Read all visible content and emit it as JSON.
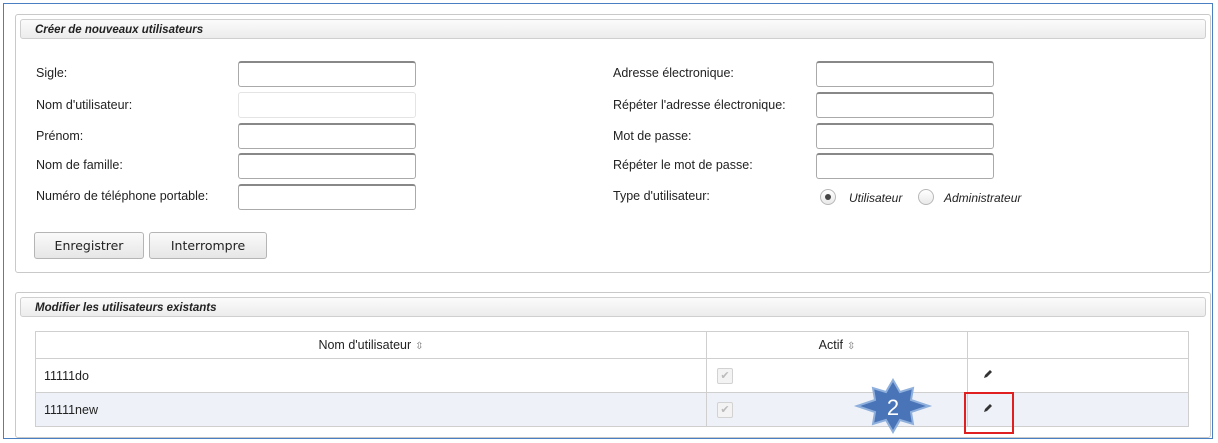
{
  "create_panel": {
    "title": "Créer de nouveaux utilisateurs",
    "fields_left": [
      {
        "label": "Sigle:"
      },
      {
        "label": "Nom d'utilisateur:"
      },
      {
        "label": "Prénom:"
      },
      {
        "label": "Nom de famille:"
      },
      {
        "label": "Numéro de téléphone portable:"
      }
    ],
    "fields_right": [
      {
        "label": "Adresse électronique:"
      },
      {
        "label": "Répéter l'adresse électronique:"
      },
      {
        "label": "Mot de passe:"
      },
      {
        "label": "Répéter le mot de passe:"
      }
    ],
    "user_type": {
      "label": "Type d'utilisateur:",
      "options": [
        "Utilisateur",
        "Administrateur"
      ],
      "selected": "Utilisateur"
    },
    "buttons": {
      "save": "Enregistrer",
      "cancel": "Interrompre"
    }
  },
  "edit_panel": {
    "title": "Modifier les utilisateurs existants",
    "columns": [
      "Nom d'utilisateur",
      "Actif",
      ""
    ],
    "sort_icon": "⇳",
    "rows": [
      {
        "username": "11111do",
        "active": true
      },
      {
        "username": "11111new",
        "active": true
      }
    ]
  },
  "callout": {
    "number": "2",
    "color": "#4a74b8"
  },
  "highlight_color": "#e02020"
}
